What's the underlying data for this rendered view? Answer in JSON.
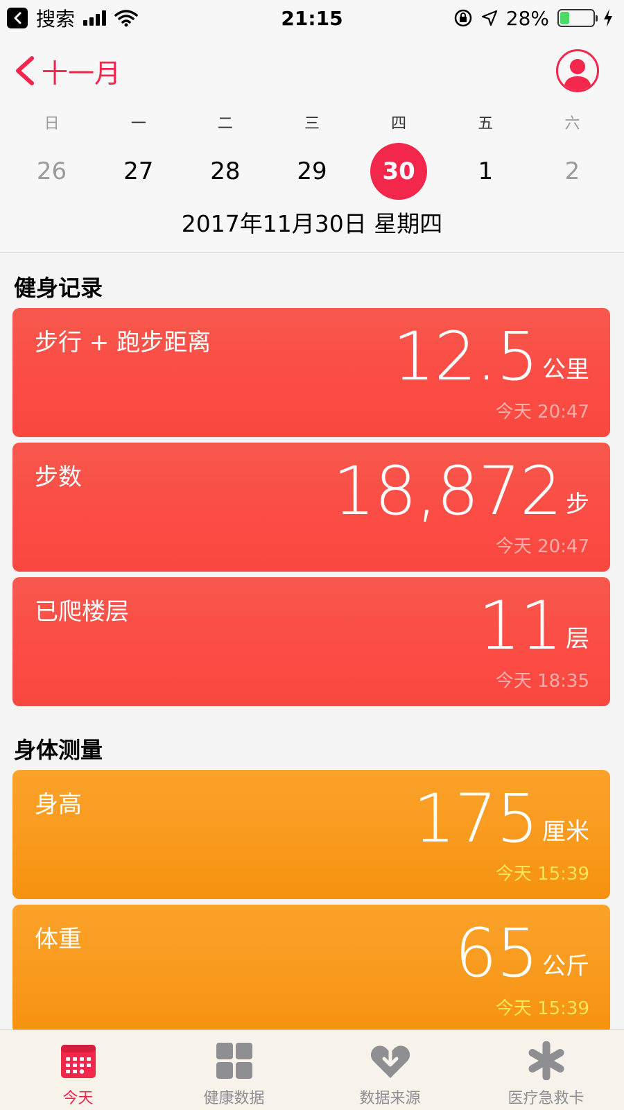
{
  "status_bar": {
    "back_app": "搜索",
    "time": "21:15",
    "battery": "28%",
    "battery_level": 0.28
  },
  "header": {
    "back_label": "十一月",
    "weekdays": [
      "日",
      "一",
      "二",
      "三",
      "四",
      "五",
      "六"
    ],
    "dates": [
      "26",
      "27",
      "28",
      "29",
      "30",
      "1",
      "2"
    ],
    "selected_date_index": 4,
    "date_title": "2017年11月30日 星期四"
  },
  "sections": {
    "fitness": {
      "title": "健身记录",
      "cards": [
        {
          "label": "步行 + 跑步距离",
          "value": "12.5",
          "unit": "公里",
          "time": "今天 20:47"
        },
        {
          "label": "步数",
          "value": "18,872",
          "unit": "步",
          "time": "今天 20:47"
        },
        {
          "label": "已爬楼层",
          "value": "11",
          "unit": "层",
          "time": "今天 18:35"
        }
      ]
    },
    "body": {
      "title": "身体测量",
      "cards": [
        {
          "label": "身高",
          "value": "175",
          "unit": "厘米",
          "time": "今天 15:39"
        },
        {
          "label": "体重",
          "value": "65",
          "unit": "公斤",
          "time": "今天 15:39"
        }
      ]
    }
  },
  "tab_bar": {
    "items": [
      {
        "label": "今天",
        "icon": "calendar-icon",
        "active": true
      },
      {
        "label": "健康数据",
        "icon": "grid-icon",
        "active": false
      },
      {
        "label": "数据来源",
        "icon": "heart-download-icon",
        "active": false
      },
      {
        "label": "医疗急救卡",
        "icon": "asterisk-icon",
        "active": false
      }
    ]
  },
  "colors": {
    "accent": "#f3264b",
    "fitness_card": "#fb4c45",
    "body_card": "#f89a1d",
    "body_card_time": "#fbe55a"
  }
}
